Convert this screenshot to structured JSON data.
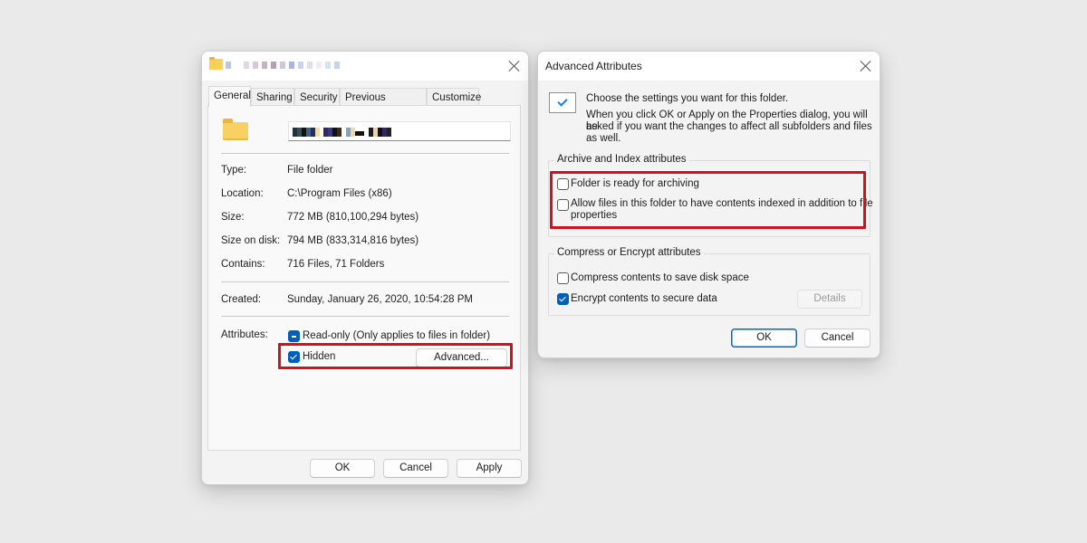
{
  "properties_dialog": {
    "title": "(blurred folder name) Properties",
    "tabs": [
      {
        "label": "General",
        "active": true
      },
      {
        "label": "Sharing",
        "active": false
      },
      {
        "label": "Security",
        "active": false
      },
      {
        "label": "Previous Versions",
        "active": false
      },
      {
        "label": "Customize",
        "active": false
      }
    ],
    "folder_name_value": "(blurred)",
    "fields": {
      "type": {
        "label": "Type:",
        "value": "File folder"
      },
      "location": {
        "label": "Location:",
        "value": "C:\\Program Files (x86)"
      },
      "size": {
        "label": "Size:",
        "value": "772 MB (810,100,294 bytes)"
      },
      "size_on_disk": {
        "label": "Size on disk:",
        "value": "794 MB (833,314,816 bytes)"
      },
      "contains": {
        "label": "Contains:",
        "value": "716 Files, 71 Folders"
      },
      "created": {
        "label": "Created:",
        "value": "Sunday, January 26, 2020, 10:54:28 PM"
      }
    },
    "attributes": {
      "label": "Attributes:",
      "read_only": {
        "label": "Read-only (Only applies to files in folder)",
        "state": "indeterminate"
      },
      "hidden": {
        "label": "Hidden",
        "state": "checked"
      },
      "advanced_button": "Advanced..."
    },
    "buttons": {
      "ok": "OK",
      "cancel": "Cancel",
      "apply": "Apply"
    }
  },
  "advanced_dialog": {
    "title": "Advanced Attributes",
    "intro_line1": "Choose the settings you want for this folder.",
    "intro_line2": "When you click OK or Apply on the Properties dialog, you will be",
    "intro_line3": "asked if you want the changes to affect all subfolders and files",
    "intro_line4": "as well.",
    "archive_group": {
      "title": "Archive and Index attributes",
      "archiving": {
        "label": "Folder is ready for archiving",
        "checked": false
      },
      "indexing": {
        "label_line1": "Allow files in this folder to have contents indexed in addition to file",
        "label_line2": "properties",
        "checked": false
      }
    },
    "compress_group": {
      "title": "Compress or Encrypt attributes",
      "compress": {
        "label": "Compress contents to save disk space",
        "checked": false
      },
      "encrypt": {
        "label": "Encrypt contents to secure data",
        "checked": true
      },
      "details_button": "Details"
    },
    "buttons": {
      "ok": "OK",
      "cancel": "Cancel"
    }
  },
  "colors": {
    "highlight": "#d0121b",
    "accent": "#005fb8"
  }
}
